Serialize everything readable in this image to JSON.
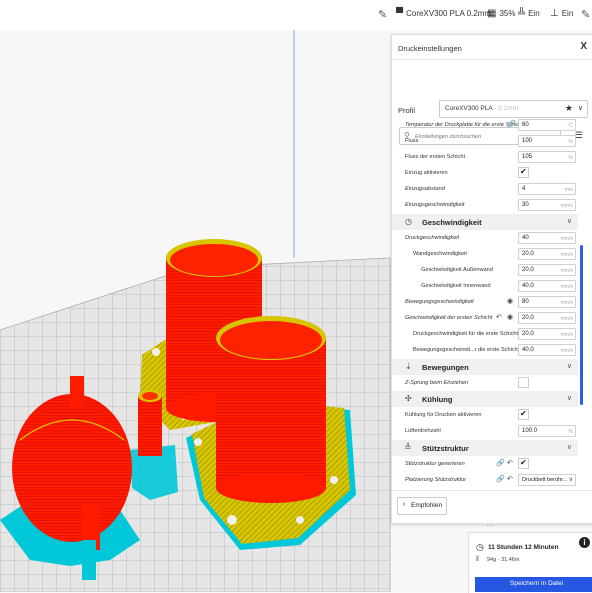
{
  "topbar": {
    "printer": "CoreXV300 PLA 0.2mm",
    "infill": "35%",
    "support": "Ein",
    "adhesion": "Ein"
  },
  "panel": {
    "title": "Druckeinstellungen",
    "close": "X",
    "profile_label": "Profil",
    "profile_value": "CoreXV300 PLA",
    "profile_suffix": "- 0.2mm",
    "search_placeholder": "Einstellungen durchsuchen"
  },
  "settings": [
    {
      "label": "Temperatur der Druckplatte für die erste Schicht",
      "value": "60",
      "unit": "°C"
    },
    {
      "label": "Fluss",
      "value": "100",
      "unit": "%"
    },
    {
      "label": "Fluss der ersten Schicht",
      "value": "105",
      "unit": "%"
    },
    {
      "label": "Einzug aktivieren",
      "checked": true
    },
    {
      "label": "Einzugsabstand",
      "value": "4",
      "unit": "mm"
    },
    {
      "label": "Einzugsgeschwindigkeit",
      "value": "30",
      "unit": "mm/s"
    }
  ],
  "categories": {
    "speed": "Geschwindigkeit",
    "travel": "Bewegungen",
    "cooling": "Kühlung",
    "support": "Stützstruktur"
  },
  "speed_settings": [
    {
      "label": "Druckgeschwindigkeit",
      "value": "40",
      "unit": "mm/s"
    },
    {
      "label": "Wandgeschwindigkeit",
      "value": "20.0",
      "unit": "mm/s"
    },
    {
      "label": "Geschwindigkeit Außenwand",
      "value": "20.0",
      "unit": "mm/s"
    },
    {
      "label": "Geschwindigkeit Innenwand",
      "value": "40.0",
      "unit": "mm/s"
    },
    {
      "label": "Bewegungsgeschwindigkeit",
      "value": "80",
      "unit": "mm/s"
    },
    {
      "label": "Geschwindigkeit der ersten Schicht",
      "value": "20.0",
      "unit": "mm/s"
    },
    {
      "label": "Druckgeschwindigkeit für die erste Schicht",
      "value": "20.0",
      "unit": "mm/s"
    },
    {
      "label": "Bewegungsgeschwindi...r die erste Schicht",
      "value": "40.0",
      "unit": "mm/s"
    }
  ],
  "travel_settings": [
    {
      "label": "Z-Sprung beim Einziehen",
      "checked": false
    }
  ],
  "cooling_settings": [
    {
      "label": "Kühlung für Drucken aktivieren",
      "checked": true
    },
    {
      "label": "Lüfterdrehzahl",
      "value": "100.0",
      "unit": "%"
    }
  ],
  "support_settings": [
    {
      "label": "Stützstruktur generieren",
      "checked": true
    },
    {
      "label": "Platzierung Stützstruktur",
      "value": "Druckbett berühr..."
    }
  ],
  "footer": {
    "recommended": "Empfohlen"
  },
  "job": {
    "time": "11 Stunden 12 Minuten",
    "material": "94g · 31.46m",
    "save": "Speichern in Datei"
  },
  "colors": {
    "model_red": "#ff0a00",
    "support_yellow": "#d7c500",
    "base_cyan": "#00c8d8",
    "accent_blue": "#2557e3"
  }
}
